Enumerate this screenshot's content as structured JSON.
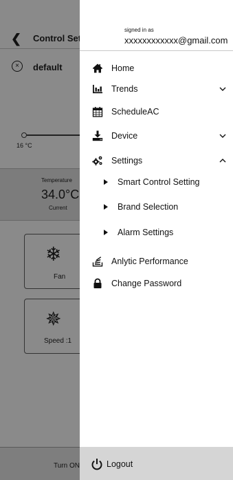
{
  "background": {
    "back_glyph": "❮",
    "title": "Control Set",
    "close_glyph": "×",
    "profile_name": "default",
    "slider_min_label": "16 °C",
    "temperature": {
      "label": "Temperature",
      "value": "34.0°C",
      "sub": "Current"
    },
    "cards": [
      {
        "icon": "snowflake-icon",
        "glyph": "❄",
        "label": "Fan"
      },
      {
        "icon": "fan-icon",
        "glyph": "✵",
        "label": "Speed :1"
      }
    ],
    "turn_button": "Turn ON"
  },
  "drawer": {
    "signed_in_label": "signed in as",
    "email": "xxxxxxxxxxxx@gmail.com",
    "menu": [
      {
        "label": "Home",
        "icon": "home-icon"
      },
      {
        "label": "Trends",
        "icon": "chart-icon",
        "chevron": "down"
      },
      {
        "label": "ScheduleAC",
        "icon": "calendar-icon"
      },
      {
        "label": "Device",
        "icon": "download-icon",
        "chevron": "down"
      },
      {
        "label": "Settings",
        "icon": "gears-icon",
        "chevron": "up"
      }
    ],
    "settings_submenu": [
      {
        "label": "Smart Control Setting"
      },
      {
        "label": "Brand Selection"
      },
      {
        "label": "Alarm Settings"
      }
    ],
    "extra_menu": [
      {
        "label": "Anlytic Performance",
        "icon": "stack-icon"
      },
      {
        "label": "Change Password",
        "icon": "lock-icon"
      }
    ],
    "logout": {
      "label": "Logout",
      "icon": "power-icon"
    }
  },
  "colors": {
    "overlay": "#8a8a8a",
    "drawer_bg": "#ffffff",
    "logout_bg": "#d5d5d5",
    "text": "#111111"
  }
}
